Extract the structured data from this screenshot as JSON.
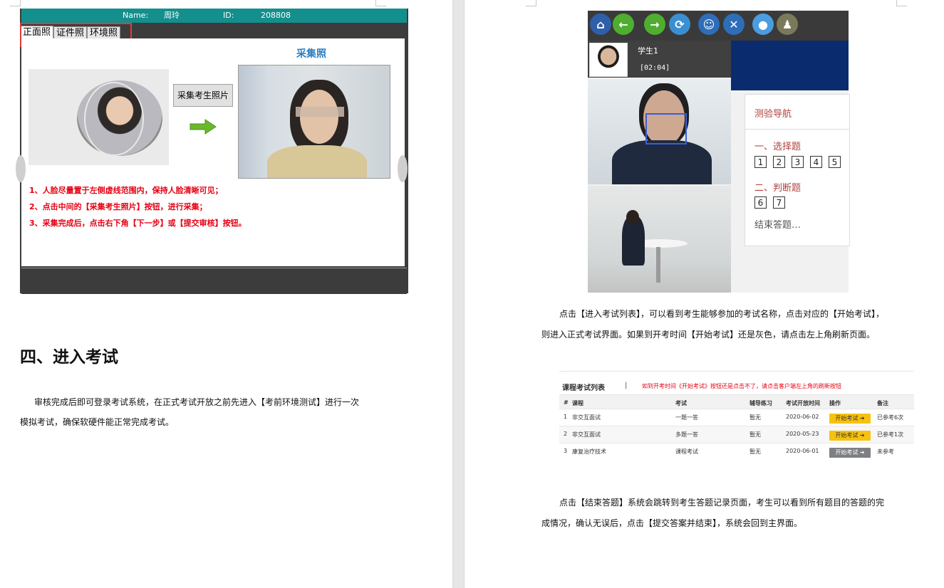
{
  "left_page": {
    "capture": {
      "header": {
        "name_label": "Name:",
        "name_value": "周玲",
        "id_label": "ID:",
        "id_value": "208808"
      },
      "tabs": [
        {
          "label": "正面照"
        },
        {
          "label": "证件照"
        },
        {
          "label": "环境照"
        }
      ],
      "title": "采集照",
      "capture_button": "采集考生照片",
      "instructions": [
        "1、人脸尽量置于左侧虚线范围内，保持人脸清晰可见；",
        "2、点击中间的【采集考生照片】按钮，进行采集；",
        "3、采集完成后，点击右下角【下一步】或【提交审核】按钮。"
      ]
    },
    "heading": "四、进入考试",
    "paragraph_lines": [
      "审核完成后即可登录考试系统，在正式考试开放之前先进入【考前环境测试】进行一次",
      "模拟考试，确保软硬件能正常完成考试。"
    ]
  },
  "right_page": {
    "exam_window": {
      "toolbar_icons": [
        "home-icon",
        "back-arrow-icon",
        "forward-arrow-icon",
        "refresh-icon",
        "accessibility-icon",
        "settings-icon",
        "chat-icon",
        "avatar-icon"
      ],
      "student_name": "学生1",
      "timer": "[02:04]",
      "nav": {
        "title": "测验导航",
        "sections": [
          {
            "title": "一、选择题",
            "questions": [
              "1",
              "2",
              "3",
              "4",
              "5"
            ]
          },
          {
            "title": "二、判断题",
            "questions": [
              "6",
              "7"
            ]
          }
        ],
        "finish_link": "结束答题…"
      }
    },
    "paragraph1_lines": [
      "点击【进入考试列表】，可以看到考生能够参加的考试名称，点击对应的【开始考试】，",
      "则进入正式考试界面。如果到开考时间【开始考试】还是灰色，请点击左上角刷新页面。"
    ],
    "course_table": {
      "title": "课程考试列表",
      "separator": "|",
      "notice": "如到开考时间《开始考试》按钮还是点击不了，请点击客户端左上角的刷新按钮",
      "columns": [
        "#",
        "课程",
        "考试",
        "辅导练习",
        "考试开放时间",
        "操作",
        "备注"
      ],
      "rows": [
        {
          "no": "1",
          "course": "非交互面试",
          "exam": "一题一答",
          "practice": "暂无",
          "open_time": "2020-06-02",
          "action": "开始考试 ➔",
          "action_state": "active",
          "note": "已参考6次"
        },
        {
          "no": "2",
          "course": "非交互面试",
          "exam": "多题一答",
          "practice": "暂无",
          "open_time": "2020-05-23",
          "action": "开始考试 ➔",
          "action_state": "active",
          "note": "已参考1次"
        },
        {
          "no": "3",
          "course": "康复治疗技术",
          "exam": "课程考试",
          "practice": "暂无",
          "open_time": "2020-06-01",
          "action": "开始考试 ➔",
          "action_state": "disabled",
          "note": "未参考"
        }
      ]
    },
    "paragraph2_lines": [
      "点击【结束答题】系统会跳转到考生答题记录页面，考生可以看到所有题目的答题的完",
      "成情况，确认无误后，点击【提交答案并结束】，系统会回到主界面。"
    ]
  },
  "colors": {
    "header_teal": "#138f8d",
    "instruction_red": "#e60012",
    "title_blue": "#2f7fc1",
    "nav_red": "#b0413e",
    "button_yellow": "#f7c20f"
  }
}
